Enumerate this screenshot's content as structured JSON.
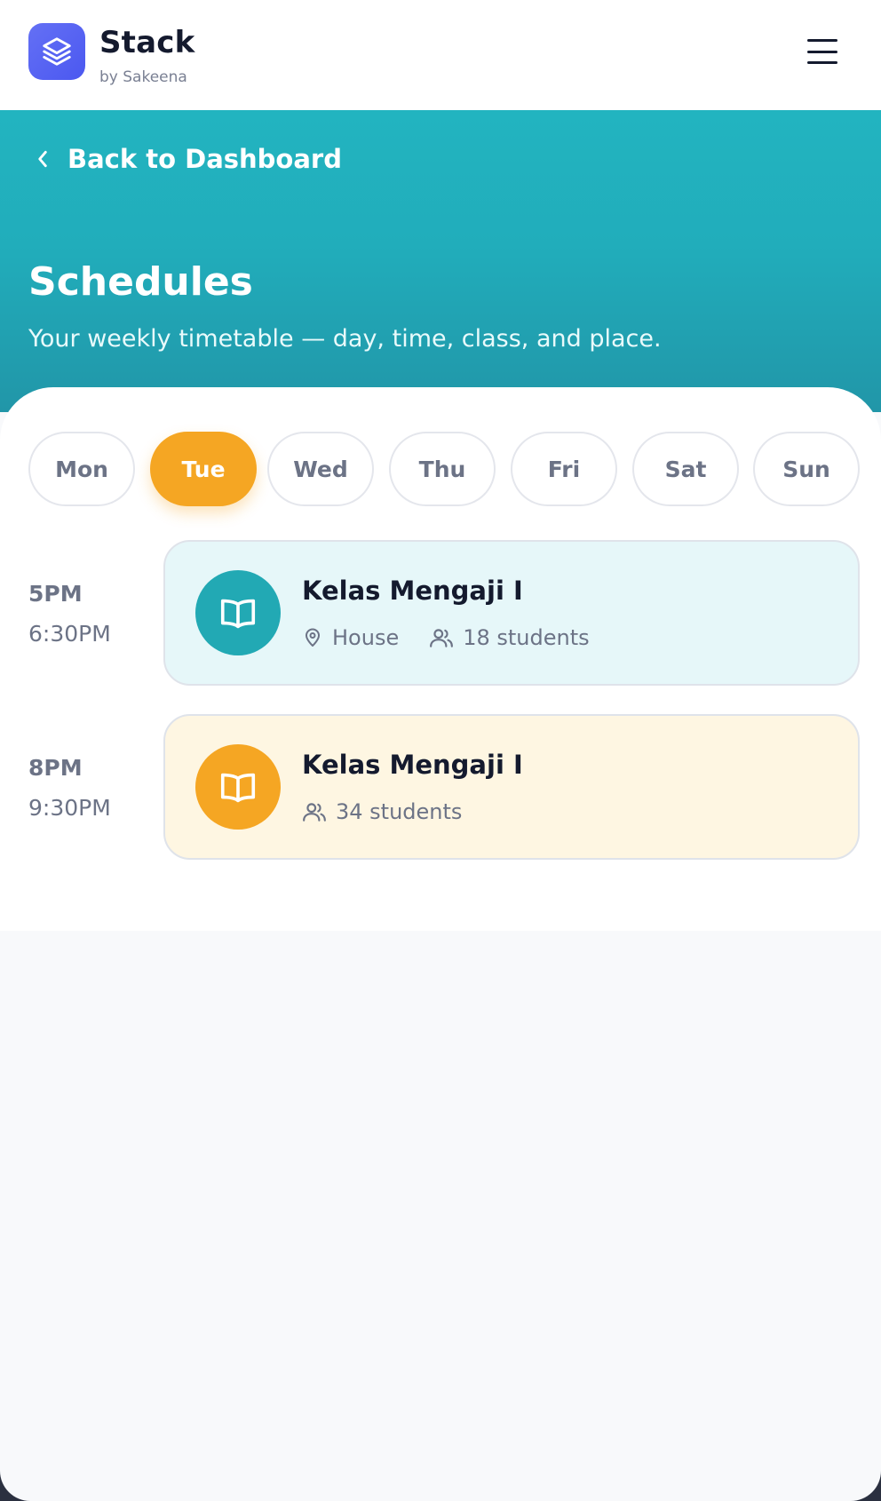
{
  "header": {
    "brand": "Stack",
    "brand_sub": "by Sakeena",
    "logo_icon": "layers-icon",
    "menu_icon": "hamburger-menu-icon"
  },
  "hero": {
    "back_label": "Back to Dashboard",
    "title": "Schedules",
    "subtitle": "Your weekly timetable — day, time, class, and place."
  },
  "days": [
    {
      "label": "Mon",
      "active": false
    },
    {
      "label": "Tue",
      "active": true
    },
    {
      "label": "Wed",
      "active": false
    },
    {
      "label": "Thu",
      "active": false
    },
    {
      "label": "Fri",
      "active": false
    },
    {
      "label": "Sat",
      "active": false
    },
    {
      "label": "Sun",
      "active": false
    }
  ],
  "schedule": [
    {
      "start": "5PM",
      "end": "6:30PM",
      "title": "Kelas Mengaji I",
      "place": "House",
      "students": "18 students",
      "color": "#22a9b4",
      "icon": "book-open-icon"
    },
    {
      "start": "8PM",
      "end": "9:30PM",
      "title": "Kelas Mengaji I",
      "students": "34 students",
      "color": "#f5a623",
      "icon": "book-open-icon"
    }
  ],
  "colors": {
    "brand": "#4b58f0",
    "hero": "#22b4c0",
    "accent": "#f5a623",
    "teal_card": "#e6f7f9",
    "amber_card": "#fef6e2"
  }
}
